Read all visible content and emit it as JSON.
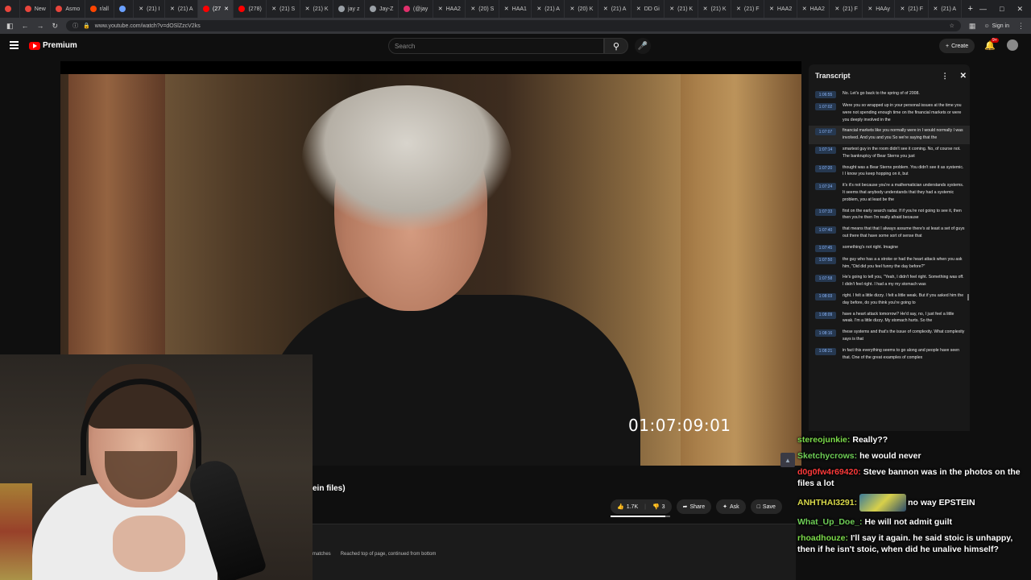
{
  "browser": {
    "tabs": [
      {
        "label": "",
        "color": "#e8453c"
      },
      {
        "label": "New",
        "color": "#e8453c"
      },
      {
        "label": "Asmo",
        "color": "#e8453c"
      },
      {
        "label": "r/all",
        "color": "#ff4500"
      },
      {
        "label": "",
        "color": "#6aa0ff"
      },
      {
        "label": "(21) I",
        "color": "#ffffff",
        "x": true
      },
      {
        "label": "(21) A",
        "color": "#ffffff",
        "x": true
      },
      {
        "label": "(27",
        "color": "#ff0000",
        "active": true
      },
      {
        "label": "(278)",
        "color": "#ff0000"
      },
      {
        "label": "(21) S",
        "color": "#ffffff",
        "x": true
      },
      {
        "label": "(21) K",
        "color": "#ffffff",
        "x": true
      },
      {
        "label": "jay z",
        "color": "#9aa0a6"
      },
      {
        "label": "Jay-Z",
        "color": "#9aa0a6"
      },
      {
        "label": "(@jay",
        "color": "#e1306c"
      },
      {
        "label": "HAA2",
        "color": "#ffffff",
        "x": true
      },
      {
        "label": "(20) S",
        "color": "#ffffff",
        "x": true
      },
      {
        "label": "HAA1",
        "color": "#ffffff",
        "x": true
      },
      {
        "label": "(21) A",
        "color": "#ffffff",
        "x": true
      },
      {
        "label": "(20) K",
        "color": "#ffffff",
        "x": true
      },
      {
        "label": "(21) A",
        "color": "#ffffff",
        "x": true
      },
      {
        "label": "DD Gi",
        "color": "#ffffff",
        "x": true
      },
      {
        "label": "(21) K",
        "color": "#ffffff",
        "x": true
      },
      {
        "label": "(21) K",
        "color": "#ffffff",
        "x": true
      },
      {
        "label": "(21) F",
        "color": "#ffffff",
        "x": true
      },
      {
        "label": "HAA2",
        "color": "#ffffff",
        "x": true
      },
      {
        "label": "HAA2",
        "color": "#ffffff",
        "x": true
      },
      {
        "label": "(21) F",
        "color": "#ffffff",
        "x": true
      },
      {
        "label": "HAAy",
        "color": "#ffffff",
        "x": true
      },
      {
        "label": "(21) F",
        "color": "#ffffff",
        "x": true
      },
      {
        "label": "(21) A",
        "color": "#ffffff",
        "x": true
      }
    ],
    "url": "www.youtube.com/watch?v=dOSlZzcV2ks",
    "signin_label": "Sign in"
  },
  "youtube": {
    "logo_label": "Premium",
    "search_placeholder": "Search",
    "create_label": "Create",
    "notif_count": "9+"
  },
  "video": {
    "timecode": "01:07:09:01",
    "title_fragment": "ein files)",
    "actions": {
      "like_count": "1.7K",
      "dislike_count": "3",
      "share_label": "Share",
      "ask_label": "Ask",
      "save_label": "Save"
    },
    "like_ratio": 0.92
  },
  "findbar": {
    "matches_label": "matches",
    "status_text": "Reached top of page, continued from bottom"
  },
  "transcript": {
    "title": "Transcript",
    "segments": [
      {
        "ts": "1:06:55",
        "text": "No. Let's go back to the spring of of 2008."
      },
      {
        "ts": "1:07:02",
        "text": "Were you so wrapped up in your personal issues at the time you were not spending enough time on the financial markets or were you deeply involved in the"
      },
      {
        "ts": "1:07:07",
        "text": "financial markets like you normally were in I would normally I was involved. And you and you So we're saying that the",
        "highlight": true
      },
      {
        "ts": "1:07:14",
        "text": "smartest guy in the room didn't see it coming. No, of course not. The bankruptcy of Bear Sterns you just"
      },
      {
        "ts": "1:07:20",
        "text": "thought was a Bear Sterns problem. You didn't see it as systemic. I I know you keep hopping on it, but"
      },
      {
        "ts": "1:07:24",
        "text": "it's it's not because you're a mathematician understands systems. It seems that anybody understands that they had a systemic problem, you at least be the"
      },
      {
        "ts": "1:07:33",
        "text": "first on the early search radar. If if you're not going to see it, then then you're then I'm really afraid because"
      },
      {
        "ts": "1:07:40",
        "text": "that means that that I always assume there's at least a set of guys out there that have some sort of sense that"
      },
      {
        "ts": "1:07:45",
        "text": "something's not right. Imagine"
      },
      {
        "ts": "1:07:50",
        "text": "the guy who has a a stroke or had the heart attack when you ask him, \"Did did you feel funny the day before?\""
      },
      {
        "ts": "1:07:58",
        "text": "He's going to tell you, \"Yeah, I didn't feel right. Something was off. I didn't feel right. I had a my my stomach was"
      },
      {
        "ts": "1:08:03",
        "text": "right. I felt a little dizzy. I felt a little weak. But if you asked him the day before, do you think you're going to"
      },
      {
        "ts": "1:08:09",
        "text": "have a heart attack tomorrow? He'd say, no, I just feel a little weak. I'm a little dizzy. My stomach hurts. So the"
      },
      {
        "ts": "1:08:16",
        "text": "these systems and that's the issue of complexity. What complexity says is that"
      },
      {
        "ts": "1:08:21",
        "text": "in fact this everything seems to go along and people have seen that. One of the great examples of complex"
      }
    ]
  },
  "chat": {
    "messages": [
      {
        "user": "stereojunkie:",
        "color": "#7cdc4a",
        "text": "Really??"
      },
      {
        "user": "Sketchycrows:",
        "color": "#6fcf57",
        "text": "he would never"
      },
      {
        "user": "d0g0fw4r69420:",
        "color": "#ff3b3b",
        "text": "Steve bannon was in the photos on the files a lot"
      },
      {
        "user": "ANHTHAI3291:",
        "color": "#d9d94a",
        "text": "no way EPSTEIN",
        "emote": true
      },
      {
        "user": "What_Up_Doe_:",
        "color": "#6fcf57",
        "text": "He will not admit guilt"
      },
      {
        "user": "rhoadhouze:",
        "color": "#7cdc4a",
        "text": "I'll say it again. he said stoic is unhappy, then if he isn't stoic, when did he unalive himself?"
      }
    ]
  }
}
